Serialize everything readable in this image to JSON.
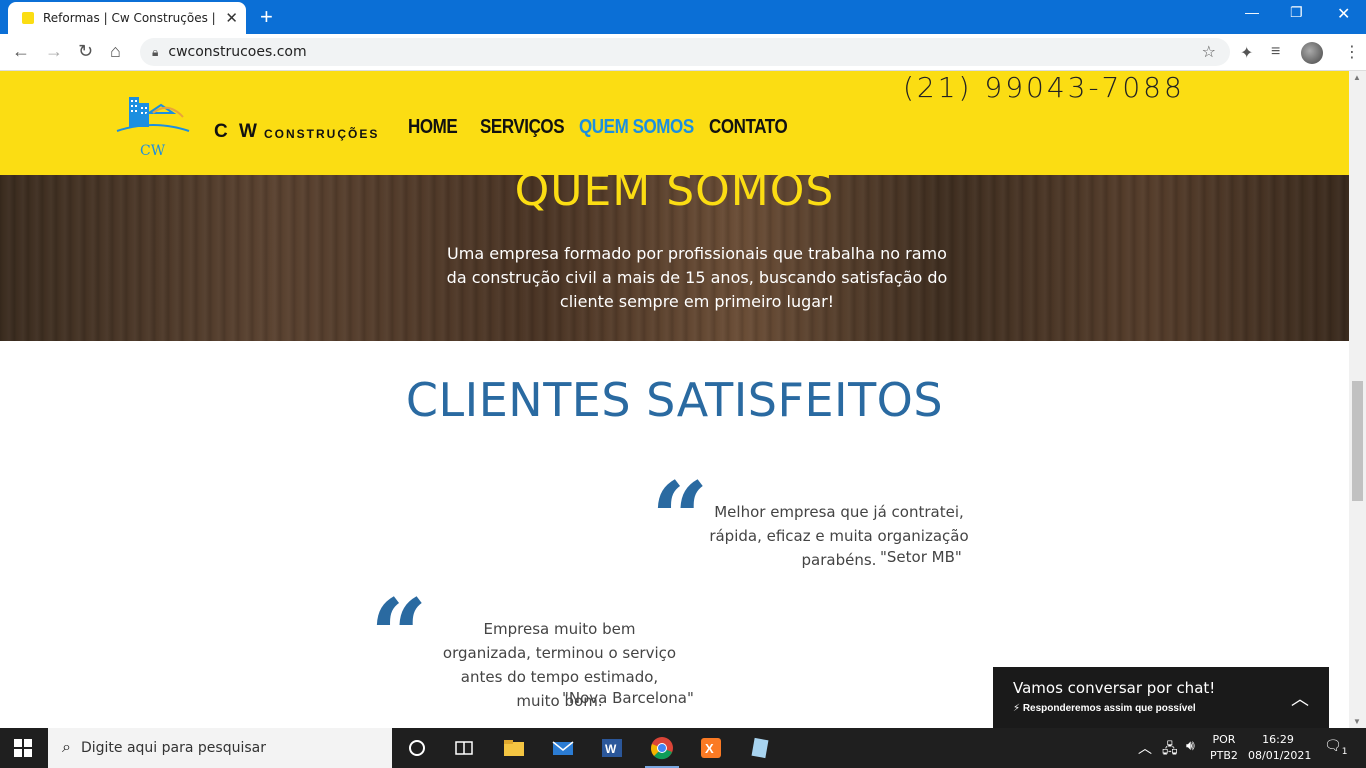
{
  "browser": {
    "tab_title": "Reformas | Cw Construções | Brasil",
    "url": "cwconstrucoes.com"
  },
  "site": {
    "brand": "C W",
    "brand_sub": "CONSTRUÇÕES",
    "logo_text": "CW",
    "phone": "(21) 99043-7088",
    "nav": [
      {
        "label": "HOME"
      },
      {
        "label": "SERVIÇOS"
      },
      {
        "label": "QUEM SOMOS"
      },
      {
        "label": "CONTATO"
      }
    ],
    "hero": {
      "title": "QUEM SOMOS",
      "text": "Uma empresa formado por profissionais que trabalha no ramo da construção civil a mais de 15 anos, buscando satisfação do cliente sempre em primeiro lugar!"
    },
    "testimonials_title": "CLIENTES SATISFEITOS",
    "testimonials": [
      {
        "text": "Melhor empresa que já contratei, rápida, eficaz e muita organização parabéns.",
        "author": "\"Setor MB\""
      },
      {
        "text": "Empresa muito bem organizada, terminou o serviço antes do tempo estimado, muito bom.",
        "author": "\"Nova Barcelona\""
      }
    ],
    "chat": {
      "title": "Vamos conversar por chat!",
      "subtitle": "Responderemos assim que possível"
    }
  },
  "taskbar": {
    "search_placeholder": "Digite aqui para pesquisar",
    "lang_top": "POR",
    "lang_bottom": "PTB2",
    "time": "16:29",
    "date": "08/01/2021",
    "notifications": "1"
  }
}
